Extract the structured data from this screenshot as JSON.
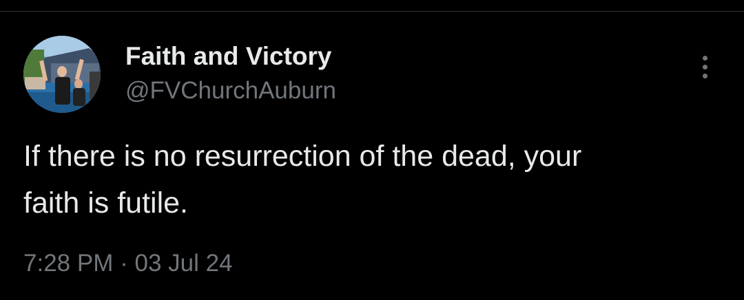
{
  "tweet": {
    "author": {
      "display_name": "Faith and Victory",
      "handle": "@FVChurchAuburn",
      "avatar_icon": "profile-photo-baptism"
    },
    "more_icon": "more-vertical-icon",
    "text": "If there is no resurrection of the dead, your\nfaith is futile.",
    "time": "7:28 PM",
    "separator": "·",
    "date": "03 Jul 24"
  },
  "colors": {
    "background": "#000000",
    "primary_text": "#e7e9ea",
    "secondary_text": "#71767b",
    "divider": "#2f3336"
  }
}
